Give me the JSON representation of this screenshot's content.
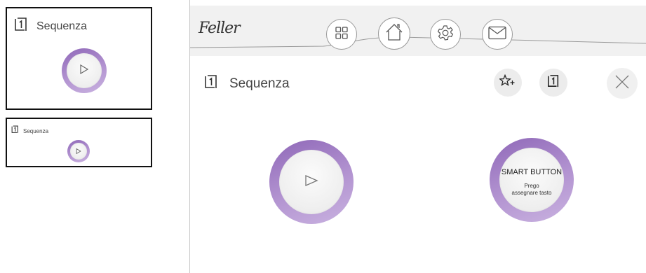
{
  "tiles": {
    "large": {
      "label": "Sequenza",
      "icon": "door-icon",
      "button_icon": "play-icon"
    },
    "small": {
      "label": "Sequenza",
      "icon": "door-icon",
      "button_icon": "play-icon"
    }
  },
  "header": {
    "brand": "Feller",
    "nav": [
      {
        "name": "grid-icon"
      },
      {
        "name": "home-icon"
      },
      {
        "name": "settings-icon"
      },
      {
        "name": "mail-icon"
      }
    ]
  },
  "panel": {
    "title": "Sequenza",
    "actions": [
      {
        "name": "favorite-add-icon"
      },
      {
        "name": "door-icon"
      },
      {
        "name": "close-icon"
      }
    ]
  },
  "smart_button": {
    "title": "SMART BUTTON",
    "subtitle_line1": "Prego",
    "subtitle_line2": "assegnare tasto"
  },
  "colors": {
    "ring_start": "#8f68b8",
    "ring_end": "#c9b2e0",
    "header_bg": "#f1f1f1"
  }
}
